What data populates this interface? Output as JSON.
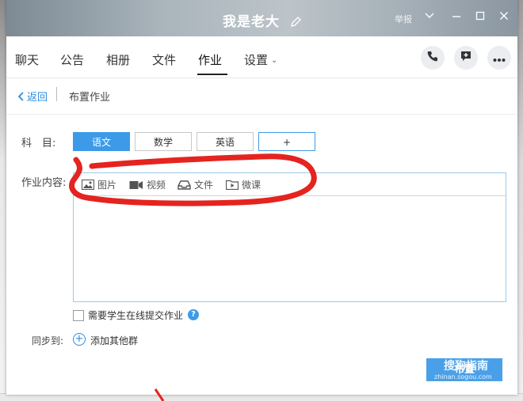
{
  "window": {
    "title": "我是老大",
    "report_label": "举报"
  },
  "nav": {
    "tabs": [
      {
        "label": "聊天"
      },
      {
        "label": "公告"
      },
      {
        "label": "相册"
      },
      {
        "label": "文件"
      },
      {
        "label": "作业"
      },
      {
        "label": "设置"
      }
    ],
    "active_tab": "作业"
  },
  "breadcrumb": {
    "back_label": "返回",
    "title": "布置作业"
  },
  "form": {
    "subject_label": "科　目:",
    "subjects": [
      "语文",
      "数学",
      "英语",
      "+"
    ],
    "active_subject": "语文",
    "content_label": "作业内容:",
    "toolbar": [
      "图片",
      "视频",
      "文件",
      "微课"
    ],
    "content_placeholder": "",
    "online_submit_label": "需要学生在线提交作业",
    "help_label": "?",
    "sync_label": "同步到:",
    "add_group_label": "添加其他群",
    "publish_label": "布置"
  },
  "watermark": {
    "brand": "搜狗指南",
    "sub": "zhinan.sogou.com"
  },
  "colors": {
    "accent": "#3d9ae8",
    "link": "#2b8be0",
    "annotation": "#e5231f"
  }
}
